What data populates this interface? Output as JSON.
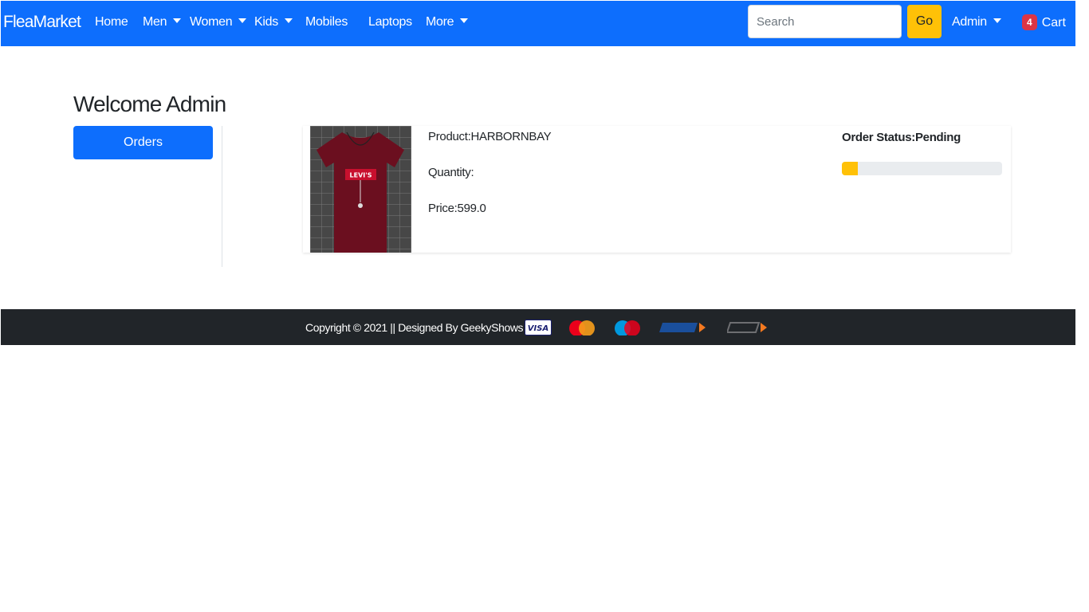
{
  "navbar": {
    "brand": "FleaMarket",
    "items": [
      {
        "label": "Home",
        "dropdown": false
      },
      {
        "label": "Men",
        "dropdown": true
      },
      {
        "label": "Women",
        "dropdown": true
      },
      {
        "label": "Kids",
        "dropdown": true
      },
      {
        "label": "Mobiles",
        "dropdown": false
      },
      {
        "label": "Laptops",
        "dropdown": false
      },
      {
        "label": "More",
        "dropdown": true
      }
    ],
    "search_placeholder": "Search",
    "search_value": "",
    "go_label": "Go",
    "user_label": "Admin",
    "cart_count": "4",
    "cart_label": "Cart"
  },
  "main": {
    "title": "Welcome Admin",
    "orders_button": "Orders",
    "order": {
      "product_line": "Product:HARBORNBAY",
      "quantity_line": "Quantity:",
      "price_line": "Price:599.0",
      "status_line": "Order Status:Pending",
      "progress_fraction": 0.1
    },
    "image_text": "LEVI'S"
  },
  "footer": {
    "text": "Copyright © 2021 || Designed By GeekyShows ||",
    "payment_icons": [
      "visa-icon",
      "mastercard-icon",
      "maestro-icon",
      "rupay-icon",
      "upi-icon"
    ]
  },
  "colors": {
    "primary": "#0d6efd",
    "warning": "#ffc107",
    "danger": "#dc3545",
    "dark": "#212529",
    "shirt": "#6b0f1f"
  }
}
